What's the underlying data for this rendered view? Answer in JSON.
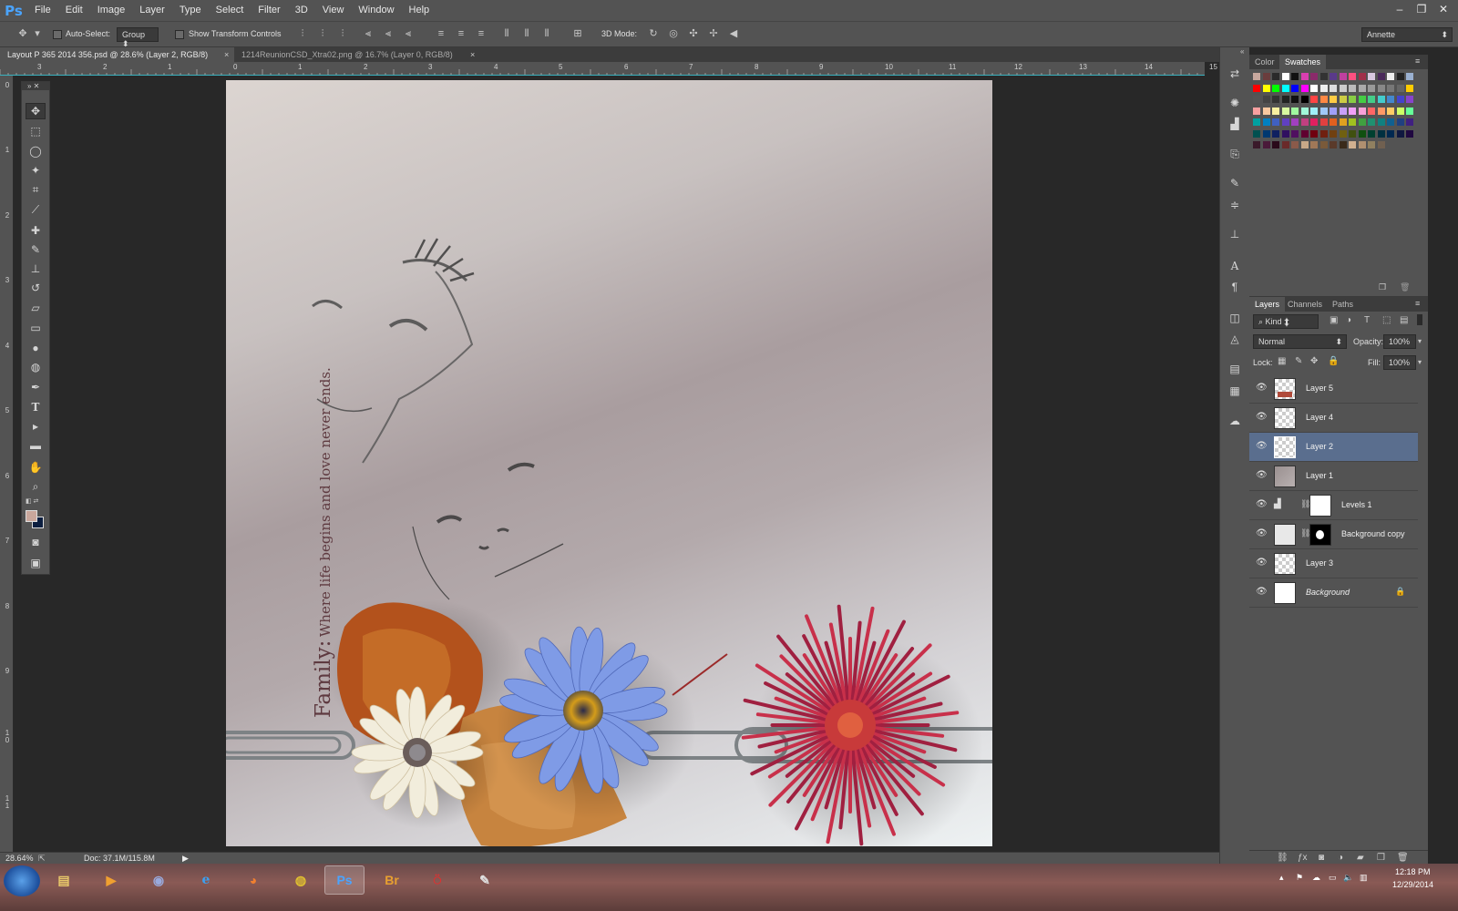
{
  "menubar": {
    "logo": "Ps",
    "items": [
      "File",
      "Edit",
      "Image",
      "Layer",
      "Type",
      "Select",
      "Filter",
      "3D",
      "View",
      "Window",
      "Help"
    ],
    "window_controls": [
      "–",
      "❐",
      "✕"
    ]
  },
  "options": {
    "auto_select_label": "Auto-Select:",
    "auto_select_value": "Group",
    "show_transform_label": "Show Transform Controls",
    "mode_3d_label": "3D Mode:",
    "workspace_value": "Annette"
  },
  "tabs": [
    {
      "label": "Layout P 365 2014 356.psd @ 28.6% (Layer 2, RGB/8)",
      "close": "×"
    },
    {
      "label": "1214ReunionCSD_Xtra02.png @ 16.7% (Layer 0, RGB/8)",
      "close": "×"
    }
  ],
  "rulers": {
    "h_ticks": [
      "3",
      "2",
      "1",
      "0",
      "1",
      "2",
      "3",
      "4",
      "5",
      "6",
      "7",
      "8",
      "9",
      "10",
      "11",
      "12",
      "13",
      "14",
      "15"
    ],
    "v_ticks": [
      "0",
      "1",
      "2",
      "3",
      "4",
      "5",
      "6",
      "7",
      "8",
      "9",
      "1\n0",
      "1\n1"
    ]
  },
  "canvas": {
    "quote": "Where life begins and love never ends.",
    "quote_prefix": "Family:"
  },
  "color_panel": {
    "tabs": [
      "Color",
      "Swatches"
    ],
    "active_tab": "Swatches"
  },
  "layers_panel": {
    "tabs": [
      "Layers",
      "Channels",
      "Paths"
    ],
    "kind_label": "Kind",
    "blend_mode": "Normal",
    "opacity_label": "Opacity:",
    "opacity_value": "100%",
    "lock_label": "Lock:",
    "fill_label": "Fill:",
    "fill_value": "100%",
    "layers": [
      {
        "name": "Layer 5",
        "selected": false
      },
      {
        "name": "Layer 4",
        "selected": false
      },
      {
        "name": "Layer 2",
        "selected": true
      },
      {
        "name": "Layer 1",
        "selected": false
      },
      {
        "name": "Levels 1",
        "selected": false
      },
      {
        "name": "Background copy",
        "selected": false
      },
      {
        "name": "Layer 3",
        "selected": false
      },
      {
        "name": "Background",
        "selected": false
      }
    ]
  },
  "status": {
    "zoom": "28.64%",
    "doc": "Doc: 37.1M/115.8M"
  },
  "taskbar": {
    "apps": [
      "Ps",
      "Br"
    ],
    "time": "12:18 PM",
    "date": "12/29/2014"
  },
  "colors": {
    "selected_layer": "#5a6e8e",
    "ps_blue": "#4aa4ff",
    "fg_swatch": "#c9a79c"
  }
}
